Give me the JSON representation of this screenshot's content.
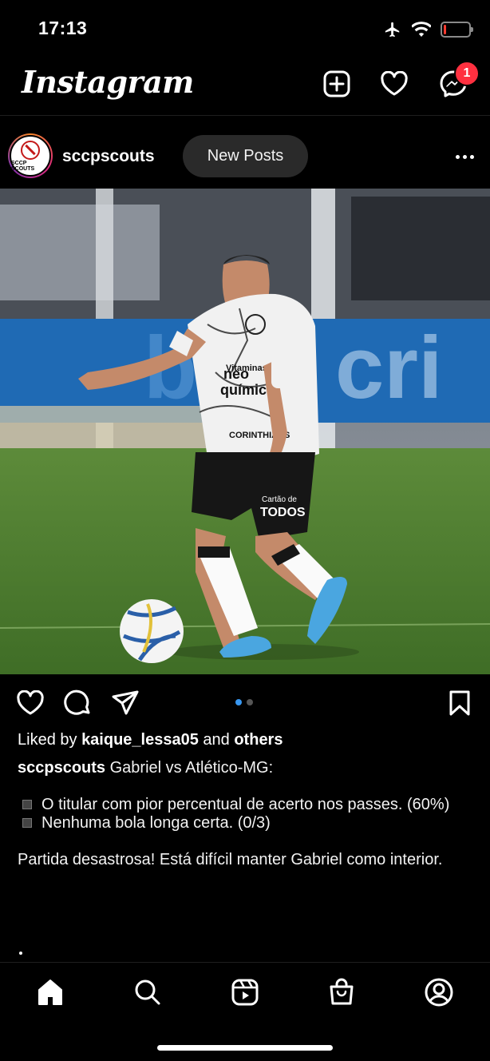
{
  "status_bar": {
    "time": "17:13",
    "battery_level": 0.1,
    "battery_color": "#ff3b30"
  },
  "header": {
    "logo": "Instagram",
    "messages_badge": "1",
    "badge_color": "#ff3040",
    "icons": [
      "plus-square-icon",
      "heart-icon",
      "messenger-icon"
    ]
  },
  "post": {
    "username": "sccpscouts",
    "avatar_text": "SCCP SCOUTS",
    "new_posts_label": "New Posts",
    "carousel": {
      "count": 2,
      "active": 0,
      "active_color": "#3897f0"
    },
    "likes": {
      "prefix": "Liked by",
      "user": "kaique_lessa05",
      "middle": "and",
      "suffix": "others"
    },
    "caption": {
      "username": "sccpscouts",
      "title": "Gabriel vs Atlético-MG:",
      "bullet1": "O titular com pior percentual de acerto nos passes. (60%)",
      "bullet2": "Nenhuma bola longa certa. (0/3)",
      "closing": "Partida desastrosa! Está difícil manter Gabriel como interior.",
      "trailing": "."
    },
    "photo": {
      "description": "Soccer player in white patterned Corinthians jersey dribbling a ball on a pitch",
      "jersey_texts": [
        "Vitaminas",
        "neo",
        "química",
        "CORINTHIANS",
        "Cartão de",
        "TODOS"
      ]
    }
  },
  "tab_bar": {
    "items": [
      "home-icon",
      "search-icon",
      "reels-icon",
      "shop-icon",
      "profile-icon"
    ],
    "active": "home"
  }
}
